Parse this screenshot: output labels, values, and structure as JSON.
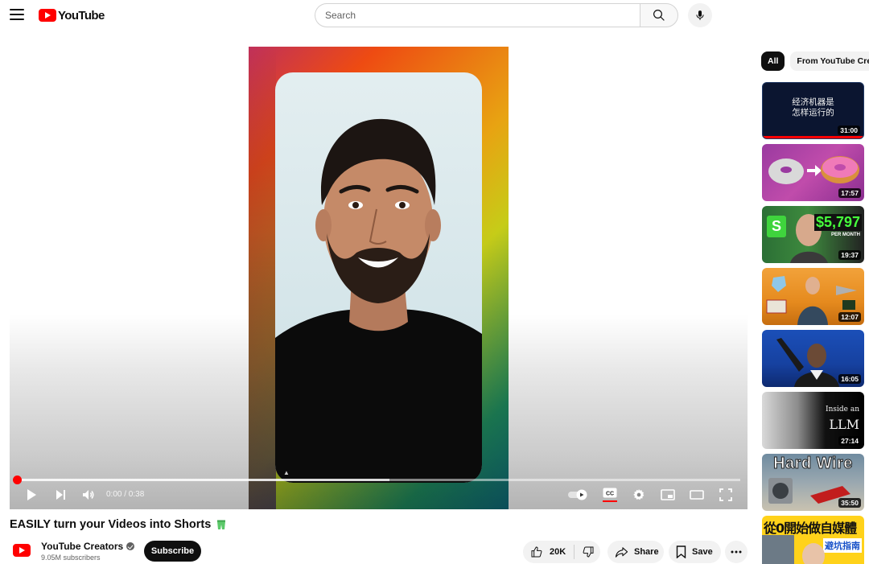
{
  "header": {
    "logo_text": "YouTube",
    "search_placeholder": "Search"
  },
  "player": {
    "time": "0:00 / 0:38",
    "progress_played_fraction": 0.0,
    "progress_buffered_fraction": 0.515,
    "icons": [
      "play-icon",
      "next-icon",
      "volume-icon",
      "autoplay-toggle",
      "captions-icon",
      "settings-icon",
      "miniplayer-icon",
      "theater-icon",
      "fullscreen-icon"
    ]
  },
  "video": {
    "title": "EASILY turn your Videos into Shorts",
    "channel_name": "YouTube Creators",
    "subscribers": "9.05M subscribers",
    "subscribe_label": "Subscribe",
    "likes": "20K",
    "share_label": "Share",
    "save_label": "Save"
  },
  "sidebar": {
    "chips": [
      "All",
      "From YouTube Creators"
    ],
    "thumbnails": [
      {
        "duration": "31:00",
        "text": "经济机器是\n怎样运行的"
      },
      {
        "duration": "17:57"
      },
      {
        "duration": "19:37",
        "amount": "$5,797",
        "sub": "PER MONTH"
      },
      {
        "duration": "12:07"
      },
      {
        "duration": "16:05"
      },
      {
        "duration": "27:14",
        "line1": "Inside an",
        "line2": "LLM"
      },
      {
        "duration": "35:50",
        "text": "Hard Wire"
      },
      {
        "text": "從0開始做自媒體",
        "tag": "避坑指南"
      }
    ]
  },
  "colors": {
    "brand_red": "#ff0000",
    "text_primary": "#0f0f0f",
    "text_secondary": "#606060",
    "chip_bg": "#f2f2f2"
  }
}
